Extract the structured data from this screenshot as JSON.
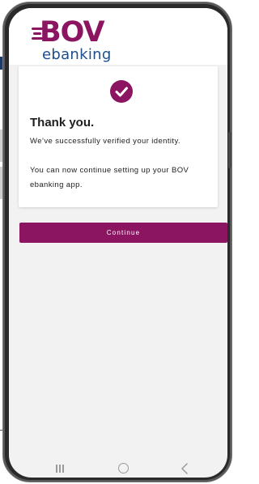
{
  "brand": {
    "logo_text": "BOV",
    "logo_subtext": "ebanking",
    "primary_color": "#8b1561",
    "secondary_color": "#1d4e8c"
  },
  "card": {
    "icon": "check-circle-icon",
    "title": "Thank you.",
    "message": "We’ve successfully verified your identity.",
    "detail": "You can now continue setting up your BOV ebanking app."
  },
  "actions": {
    "continue_label": "Continue"
  },
  "navigation": {
    "recent_apps_icon": "recent-apps-icon",
    "home_icon": "home-icon",
    "back_icon": "back-icon"
  }
}
